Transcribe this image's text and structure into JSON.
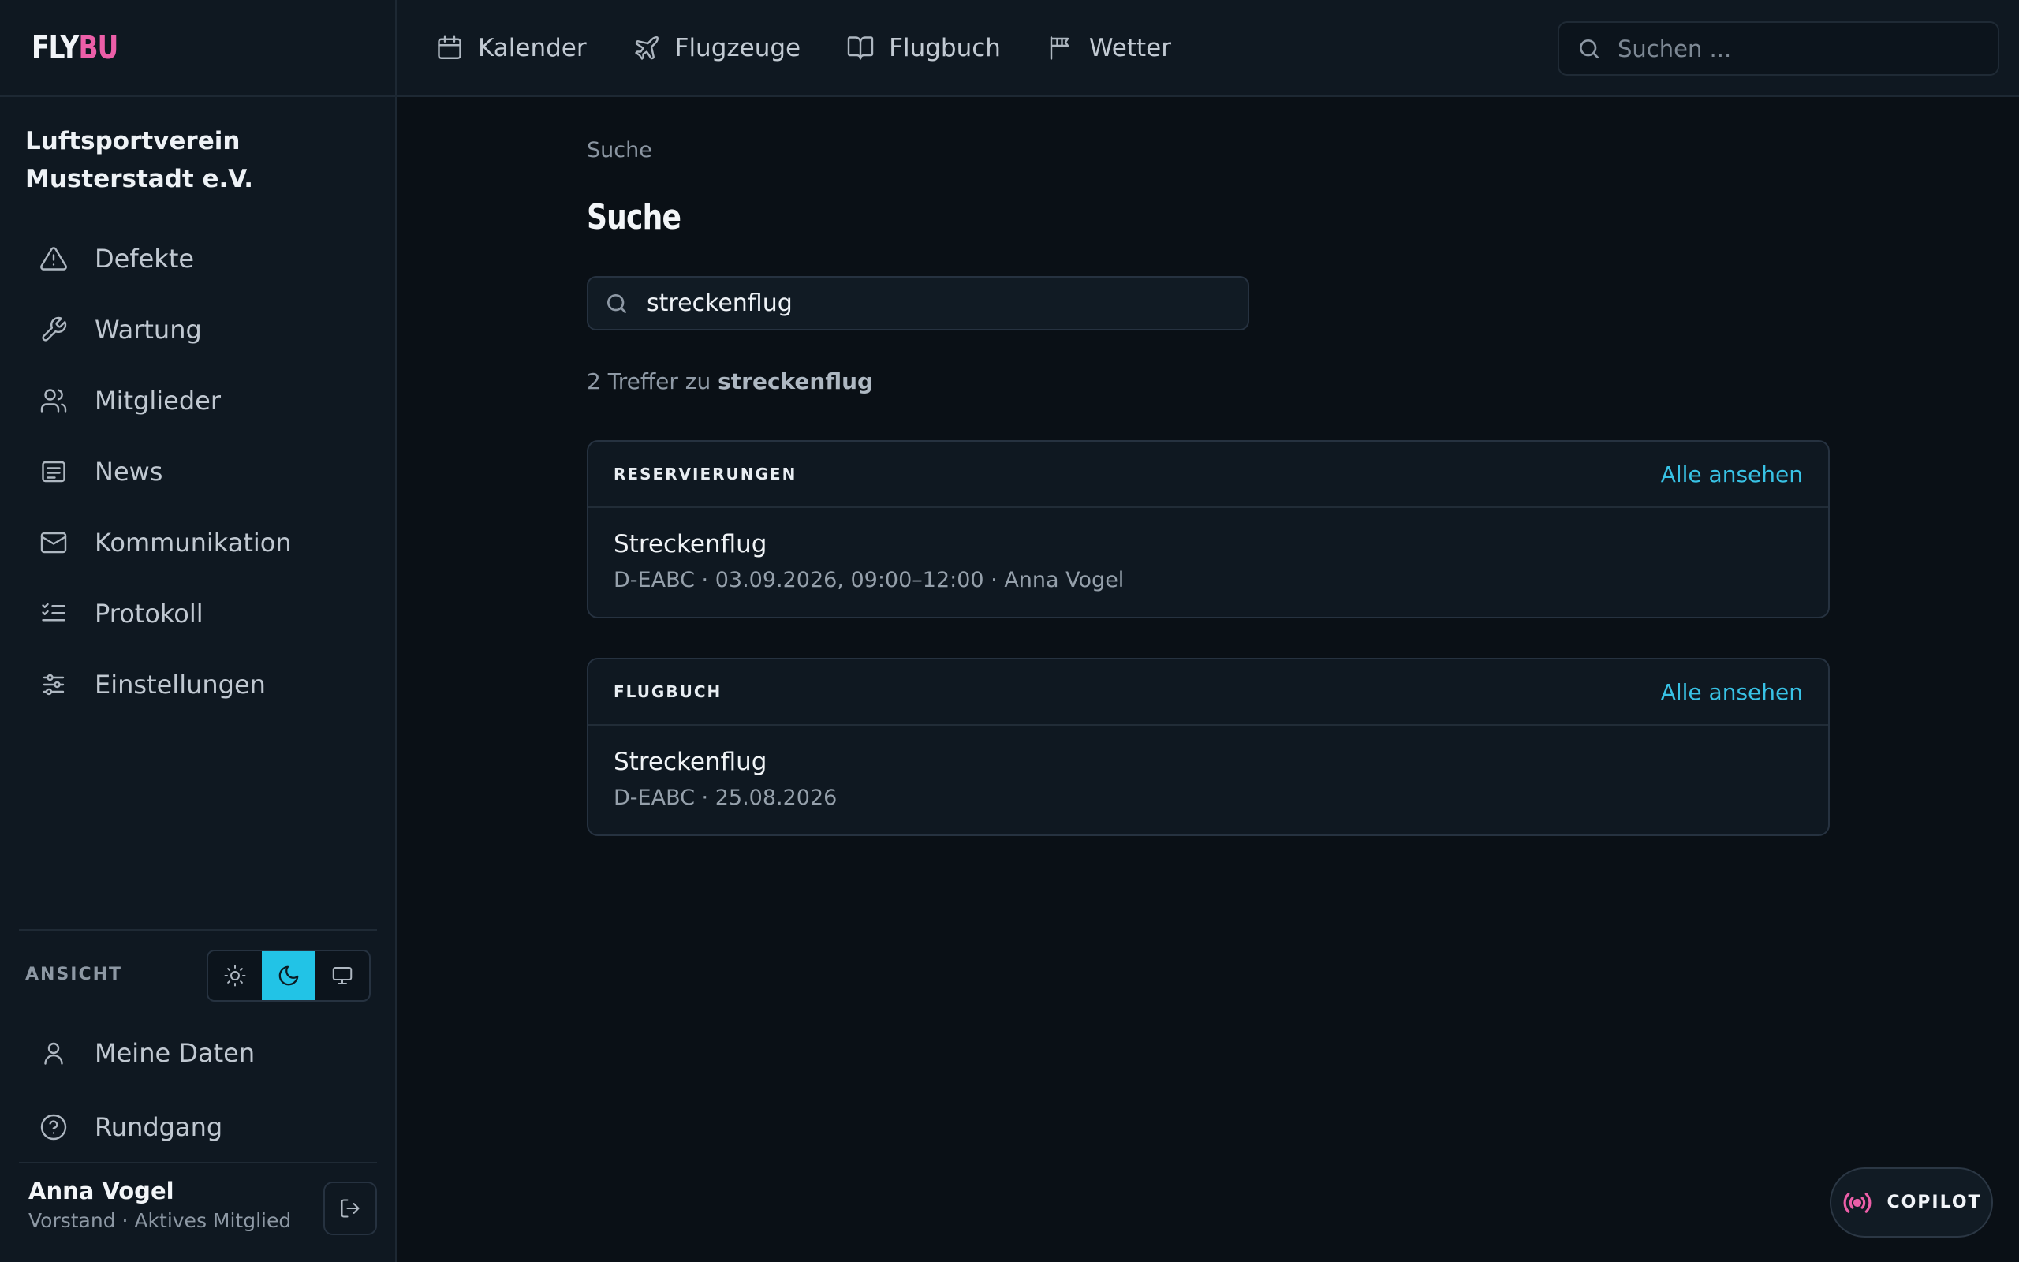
{
  "brand": {
    "part1": "FLY",
    "part2": "BU",
    "accent_color": "#ec5ea8"
  },
  "topnav": {
    "items": [
      {
        "label": "Kalender",
        "icon": "calendar-icon"
      },
      {
        "label": "Flugzeuge",
        "icon": "plane-icon"
      },
      {
        "label": "Flugbuch",
        "icon": "book-icon"
      },
      {
        "label": "Wetter",
        "icon": "windsock-icon"
      }
    ],
    "search_placeholder": "Suchen ..."
  },
  "sidebar": {
    "org_name": "Luftsportverein Musterstadt e.V.",
    "items": [
      {
        "label": "Defekte",
        "icon": "warning-icon"
      },
      {
        "label": "Wartung",
        "icon": "wrench-icon"
      },
      {
        "label": "Mitglieder",
        "icon": "users-icon"
      },
      {
        "label": "News",
        "icon": "newspaper-icon"
      },
      {
        "label": "Kommunikation",
        "icon": "mail-icon"
      },
      {
        "label": "Protokoll",
        "icon": "list-checks-icon"
      },
      {
        "label": "Einstellungen",
        "icon": "sliders-icon"
      }
    ],
    "view_label": "ANSICHT",
    "theme_options": [
      "light",
      "dark",
      "system"
    ],
    "theme_active": "dark",
    "bottom_items": [
      {
        "label": "Meine Daten",
        "icon": "user-icon"
      },
      {
        "label": "Rundgang",
        "icon": "help-circle-icon"
      }
    ],
    "user": {
      "name": "Anna Vogel",
      "role": "Vorstand · Aktives Mitglied"
    }
  },
  "main": {
    "breadcrumb": "Suche",
    "title": "Suche",
    "search_value": "streckenflug",
    "result_count_prefix": "2 Treffer zu",
    "result_query": "streckenflug",
    "sections": [
      {
        "label": "RESERVIERUNGEN",
        "link": "Alle ansehen",
        "rows": [
          {
            "title": "Streckenflug",
            "meta": "D-EABC · 03.09.2026, 09:00–12:00 · Anna Vogel"
          }
        ]
      },
      {
        "label": "FLUGBUCH",
        "link": "Alle ansehen",
        "rows": [
          {
            "title": "Streckenflug",
            "meta": "D-EABC · 25.08.2026"
          }
        ]
      }
    ]
  },
  "copilot": {
    "label": "COPILOT"
  }
}
